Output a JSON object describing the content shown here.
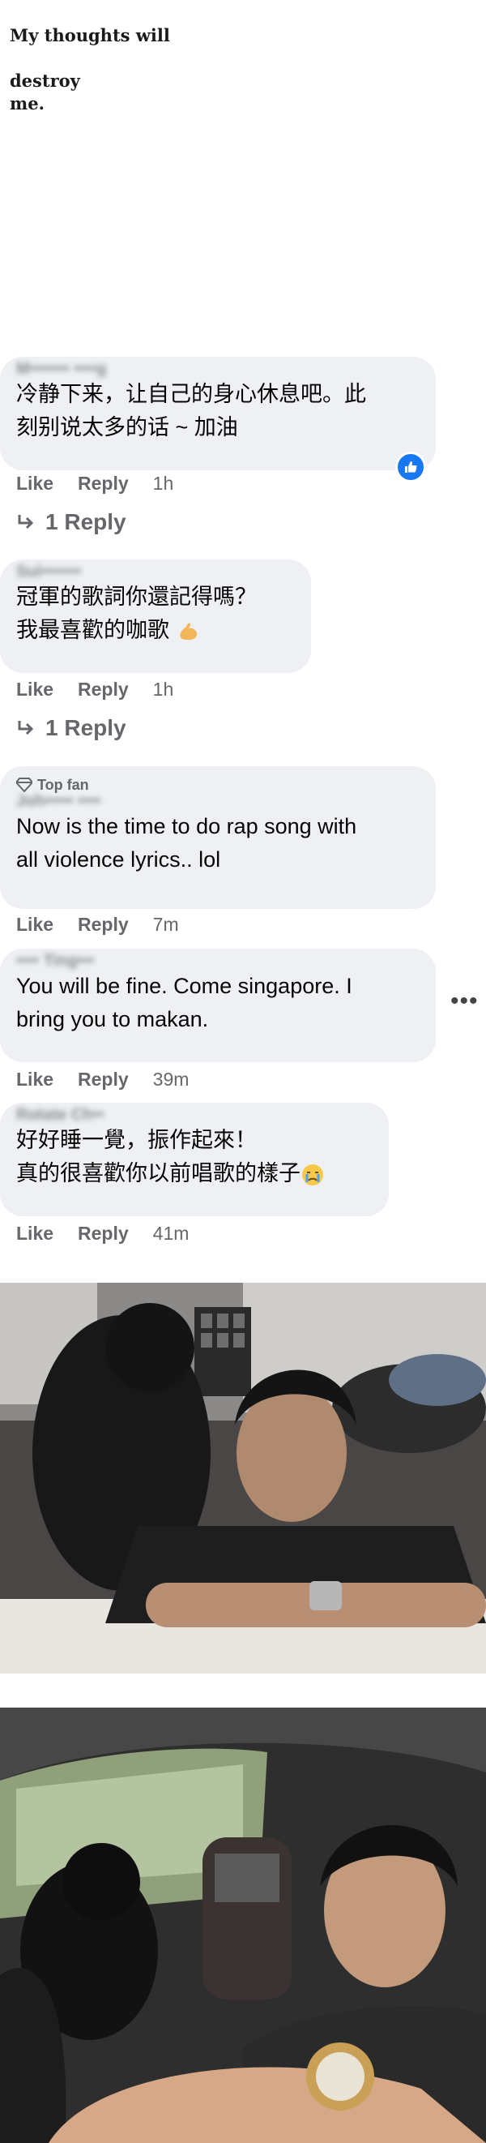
{
  "note": {
    "line1": "My thoughts will",
    "line2": "destroy",
    "line3": "me."
  },
  "comments": [
    {
      "author": "M••••••• ••••g",
      "text": "冷静下来，让自己的身心休息吧。此\n刻别说太多的话 ~ 加油",
      "like": "Like",
      "reply": "Reply",
      "time": "1h",
      "replies_label": "1 Reply"
    },
    {
      "author": "Sui•••••••",
      "text": "冠軍的歌詞你還記得嗎？\n我最喜歡的咖歌",
      "like": "Like",
      "reply": "Reply",
      "time": "1h",
      "replies_label": "1 Reply"
    },
    {
      "badge": "Top fan",
      "author": "Joh••••• ••••",
      "text": "Now is the time to do rap song with\nall violence lyrics.. lol",
      "like": "Like",
      "reply": "Reply",
      "time": "7m"
    },
    {
      "author": "•••• Ting•••",
      "text": "You will be fine. Come singapore. I\nbring you to makan.",
      "like": "Like",
      "reply": "Reply",
      "time": "39m"
    },
    {
      "author": "Rotate Ch••",
      "text": "好好睡一覺，振作起來！\n真的很喜歡你以前唱歌的樣子",
      "like": "Like",
      "reply": "Reply",
      "time": "41m"
    }
  ],
  "photos": [
    {
      "icon": "photo-man-poodle-sofa"
    },
    {
      "icon": "photo-man-poodle-car"
    }
  ],
  "colors": {
    "bubble": "#eef0f3",
    "meta": "#65676b",
    "like_blue": "#1877f2"
  }
}
